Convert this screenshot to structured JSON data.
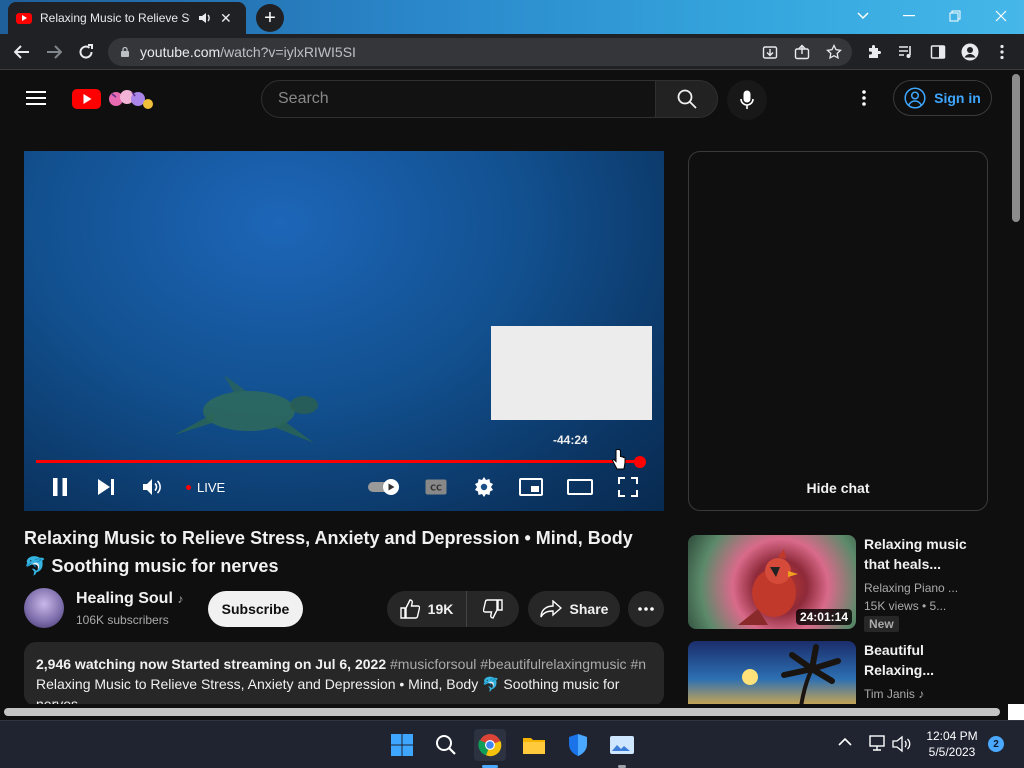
{
  "browser": {
    "tab_title": "Relaxing Music to Relieve Stress",
    "new_tab_label": "+",
    "url_host": "youtube.com",
    "url_path": "/watch?v=iylxRIWI5SI"
  },
  "header": {
    "search_placeholder": "Search",
    "sign_in_label": "Sign in"
  },
  "player": {
    "time_remaining": "-44:24",
    "live_label": "LIVE",
    "progress_fraction": 0.98
  },
  "chat": {
    "hide_chat_label": "Hide chat"
  },
  "video": {
    "title": "Relaxing Music to Relieve Stress, Anxiety and Depression • Mind, Body 🐬 Soothing music for nerves",
    "channel_name": "Healing Soul",
    "subscribers": "106K subscribers",
    "subscribe_label": "Subscribe",
    "likes": "19K",
    "share_label": "Share",
    "description_line1": "2,946 watching now  Started streaming on Jul 6, 2022",
    "description_tags": "#musicforsoul #beautifulrelaxingmusic #n",
    "description_line2": "Relaxing Music to Relieve Stress, Anxiety and Depression • Mind, Body 🐬 Soothing music for nerves"
  },
  "recommendations": [
    {
      "title": "Relaxing music that heals...",
      "channel": "Relaxing Piano ...",
      "meta": "15K views  •  5...",
      "duration": "24:01:14",
      "badge": "New"
    },
    {
      "title": "Beautiful Relaxing...",
      "channel": "Tim Janis"
    }
  ],
  "taskbar": {
    "time": "12:04 PM",
    "date": "5/5/2023",
    "notification_count": "2"
  },
  "colors": {
    "accent_red": "#ff0000",
    "link_blue": "#3ea6ff",
    "page_bg": "#0f0f0f"
  }
}
